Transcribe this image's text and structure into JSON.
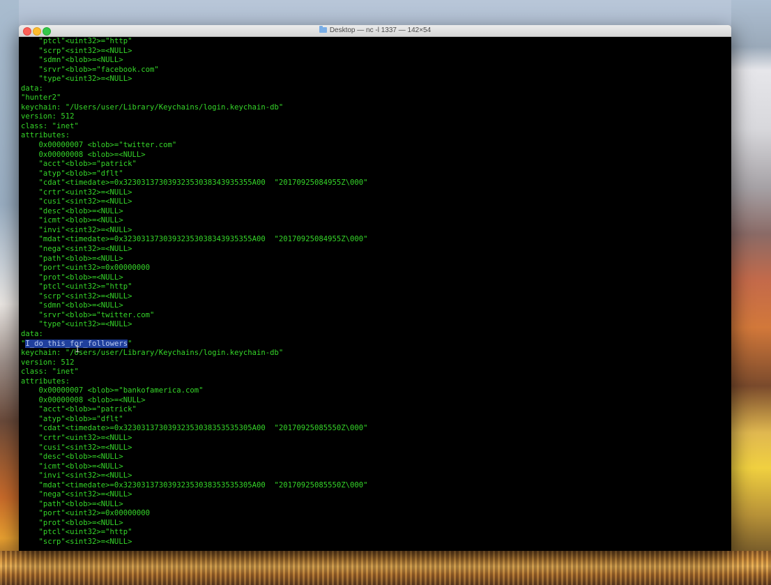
{
  "window": {
    "title": "Desktop — nc -l 1337 — 142×54"
  },
  "terminal": {
    "lines": [
      "    \"ptcl\"<uint32>=\"http\"",
      "    \"scrp\"<sint32>=<NULL>",
      "    \"sdmn\"<blob>=<NULL>",
      "    \"srvr\"<blob>=\"facebook.com\"",
      "    \"type\"<uint32>=<NULL>",
      "data:",
      "\"hunter2\"",
      "keychain: \"/Users/user/Library/Keychains/login.keychain-db\"",
      "version: 512",
      "class: \"inet\"",
      "attributes:",
      "    0x00000007 <blob>=\"twitter.com\"",
      "    0x00000008 <blob>=<NULL>",
      "    \"acct\"<blob>=\"patrick\"",
      "    \"atyp\"<blob>=\"dflt\"",
      "    \"cdat\"<timedate>=0x32303137303932353038343935355A00  \"20170925084955Z\\000\"",
      "    \"crtr\"<uint32>=<NULL>",
      "    \"cusi\"<sint32>=<NULL>",
      "    \"desc\"<blob>=<NULL>",
      "    \"icmt\"<blob>=<NULL>",
      "    \"invi\"<sint32>=<NULL>",
      "    \"mdat\"<timedate>=0x32303137303932353038343935355A00  \"20170925084955Z\\000\"",
      "    \"nega\"<sint32>=<NULL>",
      "    \"path\"<blob>=<NULL>",
      "    \"port\"<uint32>=0x00000000",
      "    \"prot\"<blob>=<NULL>",
      "    \"ptcl\"<uint32>=\"http\"",
      "    \"scrp\"<sint32>=<NULL>",
      "    \"sdmn\"<blob>=<NULL>",
      "    \"srvr\"<blob>=\"twitter.com\"",
      "    \"type\"<uint32>=<NULL>",
      "data:"
    ],
    "selected_line": {
      "quote_open": "\"",
      "selected_text": "I_do_this_for_followers",
      "quote_close": "\""
    },
    "lines_after": [
      "keychain: \"/Users/user/Library/Keychains/login.keychain-db\"",
      "version: 512",
      "class: \"inet\"",
      "attributes:",
      "    0x00000007 <blob>=\"bankofamerica.com\"",
      "    0x00000008 <blob>=<NULL>",
      "    \"acct\"<blob>=\"patrick\"",
      "    \"atyp\"<blob>=\"dflt\"",
      "    \"cdat\"<timedate>=0x32303137303932353038353535305A00  \"20170925085550Z\\000\"",
      "    \"crtr\"<uint32>=<NULL>",
      "    \"cusi\"<sint32>=<NULL>",
      "    \"desc\"<blob>=<NULL>",
      "    \"icmt\"<blob>=<NULL>",
      "    \"invi\"<sint32>=<NULL>",
      "    \"mdat\"<timedate>=0x32303137303932353038353535305A00  \"20170925085550Z\\000\"",
      "    \"nega\"<sint32>=<NULL>",
      "    \"path\"<blob>=<NULL>",
      "    \"port\"<uint32>=0x00000000",
      "    \"prot\"<blob>=<NULL>",
      "    \"ptcl\"<uint32>=\"http\"",
      "    \"scrp\"<sint32>=<NULL>"
    ]
  },
  "colors": {
    "terminal_text": "#35d629",
    "terminal_bg": "#000000",
    "selection": "#1f3f9c"
  },
  "icons": {
    "title_folder": "folder-icon",
    "mouse_cursor": "text-cursor-icon"
  }
}
